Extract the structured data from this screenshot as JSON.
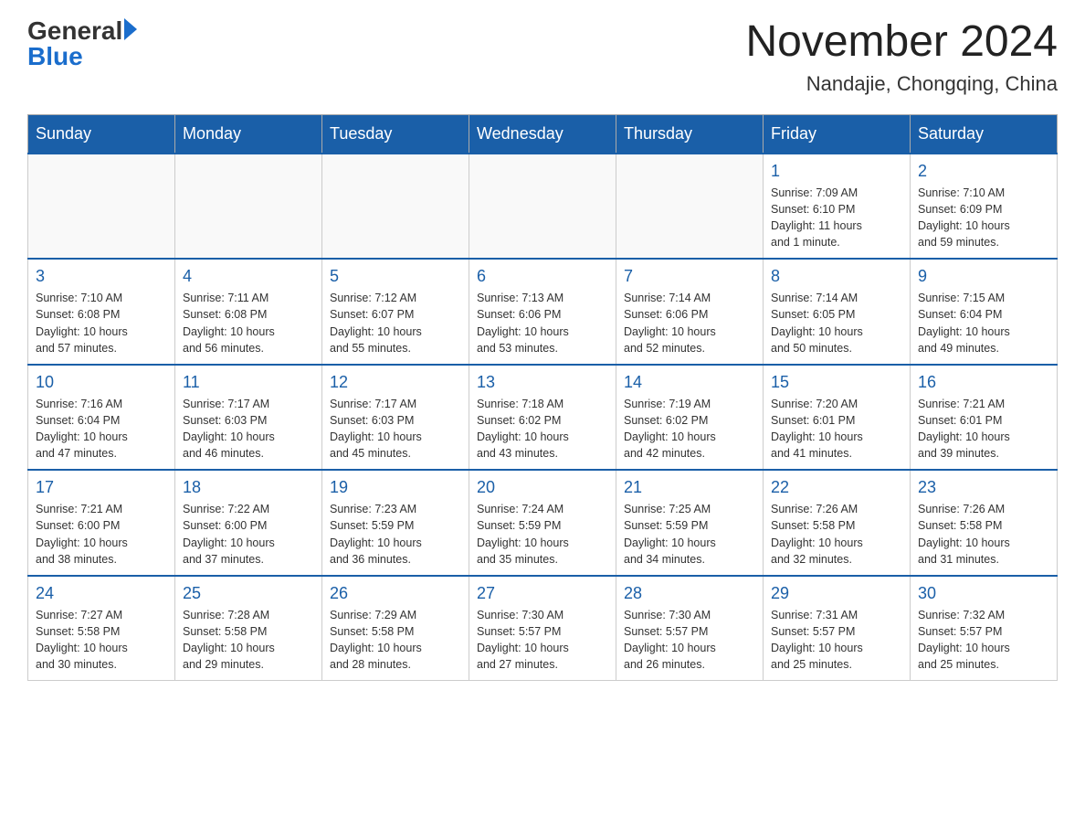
{
  "header": {
    "logo_general": "General",
    "logo_blue": "Blue",
    "month_title": "November 2024",
    "location": "Nandajie, Chongqing, China"
  },
  "days_of_week": [
    "Sunday",
    "Monday",
    "Tuesday",
    "Wednesday",
    "Thursday",
    "Friday",
    "Saturday"
  ],
  "weeks": [
    [
      {
        "day": "",
        "info": ""
      },
      {
        "day": "",
        "info": ""
      },
      {
        "day": "",
        "info": ""
      },
      {
        "day": "",
        "info": ""
      },
      {
        "day": "",
        "info": ""
      },
      {
        "day": "1",
        "info": "Sunrise: 7:09 AM\nSunset: 6:10 PM\nDaylight: 11 hours\nand 1 minute."
      },
      {
        "day": "2",
        "info": "Sunrise: 7:10 AM\nSunset: 6:09 PM\nDaylight: 10 hours\nand 59 minutes."
      }
    ],
    [
      {
        "day": "3",
        "info": "Sunrise: 7:10 AM\nSunset: 6:08 PM\nDaylight: 10 hours\nand 57 minutes."
      },
      {
        "day": "4",
        "info": "Sunrise: 7:11 AM\nSunset: 6:08 PM\nDaylight: 10 hours\nand 56 minutes."
      },
      {
        "day": "5",
        "info": "Sunrise: 7:12 AM\nSunset: 6:07 PM\nDaylight: 10 hours\nand 55 minutes."
      },
      {
        "day": "6",
        "info": "Sunrise: 7:13 AM\nSunset: 6:06 PM\nDaylight: 10 hours\nand 53 minutes."
      },
      {
        "day": "7",
        "info": "Sunrise: 7:14 AM\nSunset: 6:06 PM\nDaylight: 10 hours\nand 52 minutes."
      },
      {
        "day": "8",
        "info": "Sunrise: 7:14 AM\nSunset: 6:05 PM\nDaylight: 10 hours\nand 50 minutes."
      },
      {
        "day": "9",
        "info": "Sunrise: 7:15 AM\nSunset: 6:04 PM\nDaylight: 10 hours\nand 49 minutes."
      }
    ],
    [
      {
        "day": "10",
        "info": "Sunrise: 7:16 AM\nSunset: 6:04 PM\nDaylight: 10 hours\nand 47 minutes."
      },
      {
        "day": "11",
        "info": "Sunrise: 7:17 AM\nSunset: 6:03 PM\nDaylight: 10 hours\nand 46 minutes."
      },
      {
        "day": "12",
        "info": "Sunrise: 7:17 AM\nSunset: 6:03 PM\nDaylight: 10 hours\nand 45 minutes."
      },
      {
        "day": "13",
        "info": "Sunrise: 7:18 AM\nSunset: 6:02 PM\nDaylight: 10 hours\nand 43 minutes."
      },
      {
        "day": "14",
        "info": "Sunrise: 7:19 AM\nSunset: 6:02 PM\nDaylight: 10 hours\nand 42 minutes."
      },
      {
        "day": "15",
        "info": "Sunrise: 7:20 AM\nSunset: 6:01 PM\nDaylight: 10 hours\nand 41 minutes."
      },
      {
        "day": "16",
        "info": "Sunrise: 7:21 AM\nSunset: 6:01 PM\nDaylight: 10 hours\nand 39 minutes."
      }
    ],
    [
      {
        "day": "17",
        "info": "Sunrise: 7:21 AM\nSunset: 6:00 PM\nDaylight: 10 hours\nand 38 minutes."
      },
      {
        "day": "18",
        "info": "Sunrise: 7:22 AM\nSunset: 6:00 PM\nDaylight: 10 hours\nand 37 minutes."
      },
      {
        "day": "19",
        "info": "Sunrise: 7:23 AM\nSunset: 5:59 PM\nDaylight: 10 hours\nand 36 minutes."
      },
      {
        "day": "20",
        "info": "Sunrise: 7:24 AM\nSunset: 5:59 PM\nDaylight: 10 hours\nand 35 minutes."
      },
      {
        "day": "21",
        "info": "Sunrise: 7:25 AM\nSunset: 5:59 PM\nDaylight: 10 hours\nand 34 minutes."
      },
      {
        "day": "22",
        "info": "Sunrise: 7:26 AM\nSunset: 5:58 PM\nDaylight: 10 hours\nand 32 minutes."
      },
      {
        "day": "23",
        "info": "Sunrise: 7:26 AM\nSunset: 5:58 PM\nDaylight: 10 hours\nand 31 minutes."
      }
    ],
    [
      {
        "day": "24",
        "info": "Sunrise: 7:27 AM\nSunset: 5:58 PM\nDaylight: 10 hours\nand 30 minutes."
      },
      {
        "day": "25",
        "info": "Sunrise: 7:28 AM\nSunset: 5:58 PM\nDaylight: 10 hours\nand 29 minutes."
      },
      {
        "day": "26",
        "info": "Sunrise: 7:29 AM\nSunset: 5:58 PM\nDaylight: 10 hours\nand 28 minutes."
      },
      {
        "day": "27",
        "info": "Sunrise: 7:30 AM\nSunset: 5:57 PM\nDaylight: 10 hours\nand 27 minutes."
      },
      {
        "day": "28",
        "info": "Sunrise: 7:30 AM\nSunset: 5:57 PM\nDaylight: 10 hours\nand 26 minutes."
      },
      {
        "day": "29",
        "info": "Sunrise: 7:31 AM\nSunset: 5:57 PM\nDaylight: 10 hours\nand 25 minutes."
      },
      {
        "day": "30",
        "info": "Sunrise: 7:32 AM\nSunset: 5:57 PM\nDaylight: 10 hours\nand 25 minutes."
      }
    ]
  ]
}
